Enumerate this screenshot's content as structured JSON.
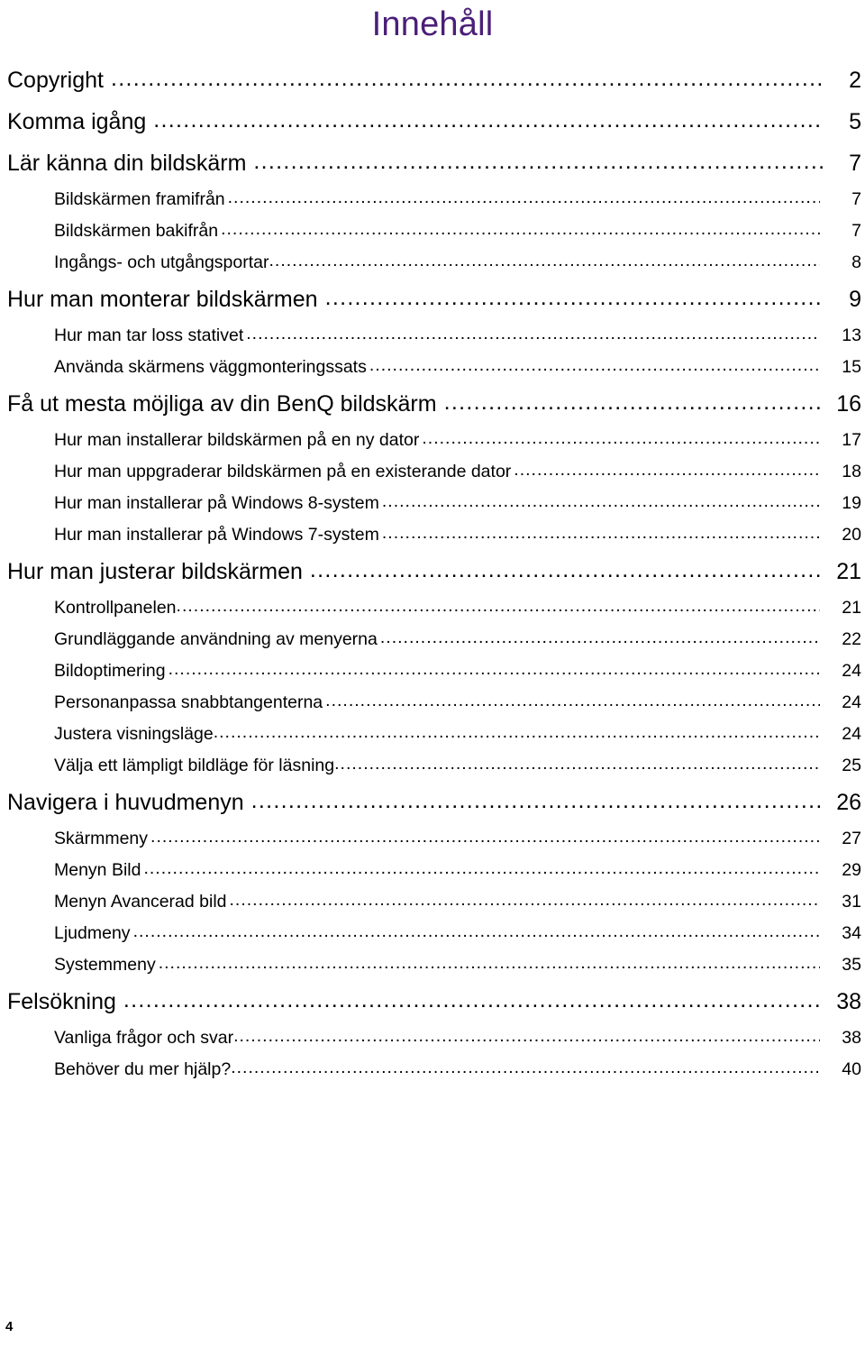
{
  "document": {
    "title": "Innehåll",
    "title_color": "#4B1F78",
    "footer_page_number": "4"
  },
  "toc": {
    "entries": [
      {
        "level": 1,
        "label": "Copyright",
        "page": "2",
        "tight": false
      },
      {
        "level": 1,
        "label": "Komma igång",
        "page": "5",
        "tight": false
      },
      {
        "level": 1,
        "label": "Lär känna din bildskärm",
        "page": "7",
        "tight": false
      },
      {
        "level": 2,
        "label": "Bildskärmen framifrån",
        "page": "7",
        "tight": false
      },
      {
        "level": 2,
        "label": "Bildskärmen bakifrån",
        "page": "7",
        "tight": false
      },
      {
        "level": 2,
        "label": "Ingångs- och utgångsportar",
        "page": "8",
        "tight": true
      },
      {
        "level": 1,
        "label": "Hur man monterar bildskärmen",
        "page": "9",
        "tight": false
      },
      {
        "level": 2,
        "label": "Hur man tar loss stativet",
        "page": "13",
        "tight": false
      },
      {
        "level": 2,
        "label": "Använda skärmens väggmonteringssats",
        "page": "15",
        "tight": false
      },
      {
        "level": 1,
        "label": "Få ut mesta möjliga av din BenQ bildskärm",
        "page": "16",
        "tight": false
      },
      {
        "level": 2,
        "label": "Hur man installerar bildskärmen på en ny dator",
        "page": "17",
        "tight": false
      },
      {
        "level": 2,
        "label": "Hur man uppgraderar bildskärmen på en existerande dator",
        "page": "18",
        "tight": false
      },
      {
        "level": 2,
        "label": "Hur man installerar på Windows 8-system",
        "page": "19",
        "tight": false
      },
      {
        "level": 2,
        "label": "Hur man installerar på Windows 7-system",
        "page": "20",
        "tight": false
      },
      {
        "level": 1,
        "label": "Hur man justerar bildskärmen",
        "page": "21",
        "tight": false
      },
      {
        "level": 2,
        "label": "Kontrollpanelen",
        "page": "21",
        "tight": true
      },
      {
        "level": 2,
        "label": "Grundläggande användning av menyerna",
        "page": "22",
        "tight": false
      },
      {
        "level": 2,
        "label": "Bildoptimering",
        "page": "24",
        "tight": false
      },
      {
        "level": 2,
        "label": "Personanpassa snabbtangenterna",
        "page": "24",
        "tight": false
      },
      {
        "level": 2,
        "label": "Justera visningsläge",
        "page": "24",
        "tight": true
      },
      {
        "level": 2,
        "label": "Välja ett lämpligt bildläge för läsning",
        "page": "25",
        "tight": true
      },
      {
        "level": 1,
        "label": "Navigera i huvudmenyn",
        "page": "26",
        "tight": false
      },
      {
        "level": 2,
        "label": "Skärmmeny",
        "page": "27",
        "tight": false
      },
      {
        "level": 2,
        "label": "Menyn Bild",
        "page": "29",
        "tight": false
      },
      {
        "level": 2,
        "label": "Menyn Avancerad bild",
        "page": "31",
        "tight": false
      },
      {
        "level": 2,
        "label": "Ljudmeny",
        "page": "34",
        "tight": false
      },
      {
        "level": 2,
        "label": "Systemmeny",
        "page": "35",
        "tight": false
      },
      {
        "level": 1,
        "label": "Felsökning",
        "page": "38",
        "tight": false
      },
      {
        "level": 2,
        "label": "Vanliga frågor och svar",
        "page": "38",
        "tight": true
      },
      {
        "level": 2,
        "label": "Behöver du mer hjälp?",
        "page": "40",
        "tight": true
      }
    ]
  }
}
